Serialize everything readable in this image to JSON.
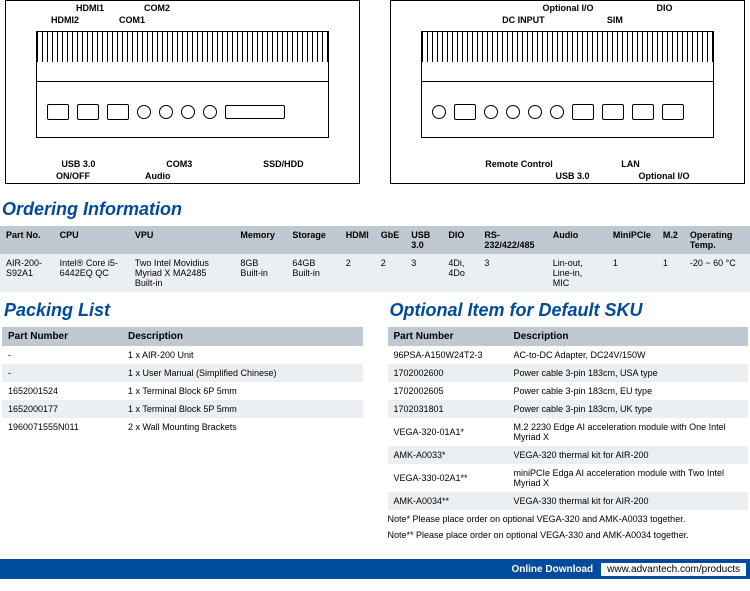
{
  "diagram_front": {
    "top": [
      "HDMI1",
      "COM2"
    ],
    "top2": [
      "HDMI2",
      "COM1"
    ],
    "bottom1": [
      "USB 3.0",
      "COM3",
      "SSD/HDD"
    ],
    "bottom2": [
      "ON/OFF",
      "Audio"
    ]
  },
  "diagram_back": {
    "top": [
      "Optional I/O",
      "DIO"
    ],
    "top2": [
      "DC INPUT",
      "SIM"
    ],
    "bottom1": [
      "Remote Control",
      "LAN"
    ],
    "bottom2": [
      "USB 3.0",
      "Optional I/O"
    ]
  },
  "ordering_title": "Ordering Information",
  "ordering_headers": [
    "Part No.",
    "CPU",
    "VPU",
    "Memory",
    "Storage",
    "HDMI",
    "GbE",
    "USB 3.0",
    "DIO",
    "RS-232/422/485",
    "Audio",
    "MiniPCIe",
    "M.2",
    "Operating Temp."
  ],
  "ordering_row": [
    "AIR-200-S92A1",
    "Intel® Core i5-6442EQ QC",
    "Two Intel Movidius Myriad X MA2485 Built-in",
    "8GB Built-in",
    "64GB Built-in",
    "2",
    "2",
    "3",
    "4Di, 4Do",
    "3",
    "Lin-out, Line-in, MIC",
    "1",
    "1",
    "-20 ~ 60 °C"
  ],
  "packing_title": "Packing List",
  "packing_headers": [
    "Part Number",
    "Description"
  ],
  "packing_rows": [
    [
      "-",
      "1 x AIR-200 Unit"
    ],
    [
      "-",
      "1 x User Manual (Simplified Chinese)"
    ],
    [
      "1652001524",
      "1 x Terminal Block 6P 5mm"
    ],
    [
      "1652000177",
      "1 x Terminal Block 5P 5mm"
    ],
    [
      "1960071555N011",
      "2 x Wall Mounting Brackets"
    ]
  ],
  "optional_title": "Optional Item for Default SKU",
  "optional_headers": [
    "Part Number",
    "Description"
  ],
  "optional_rows": [
    [
      "96PSA-A150W24T2-3",
      "AC-to-DC Adapter, DC24V/150W"
    ],
    [
      "1702002600",
      "Power cable 3-pin 183cm, USA type"
    ],
    [
      "1702002605",
      "Power cable 3-pin 183cm, EU type"
    ],
    [
      "1702031801",
      "Power cable 3-pin 183cm, UK type"
    ],
    [
      "VEGA-320-01A1*",
      "M.2 2230 Edge AI acceleration module with One Intel Myriad X"
    ],
    [
      "AMK-A0033*",
      "VEGA-320 thermal kit for AIR-200"
    ],
    [
      "VEGA-330-02A1**",
      "miniPCIe Edga AI acceleration module with Two Intel Myriad X"
    ],
    [
      "AMK-A0034**",
      "VEGA-330 thermal kit for AIR-200"
    ]
  ],
  "note1": "Note* Please place order on optional VEGA-320 and AMK-A0033 together.",
  "note2": "Note** Please place order on optional VEGA-330 and AMK-A0034 together.",
  "footer": {
    "label": "Online Download",
    "url": "www.advantech.com/products"
  }
}
